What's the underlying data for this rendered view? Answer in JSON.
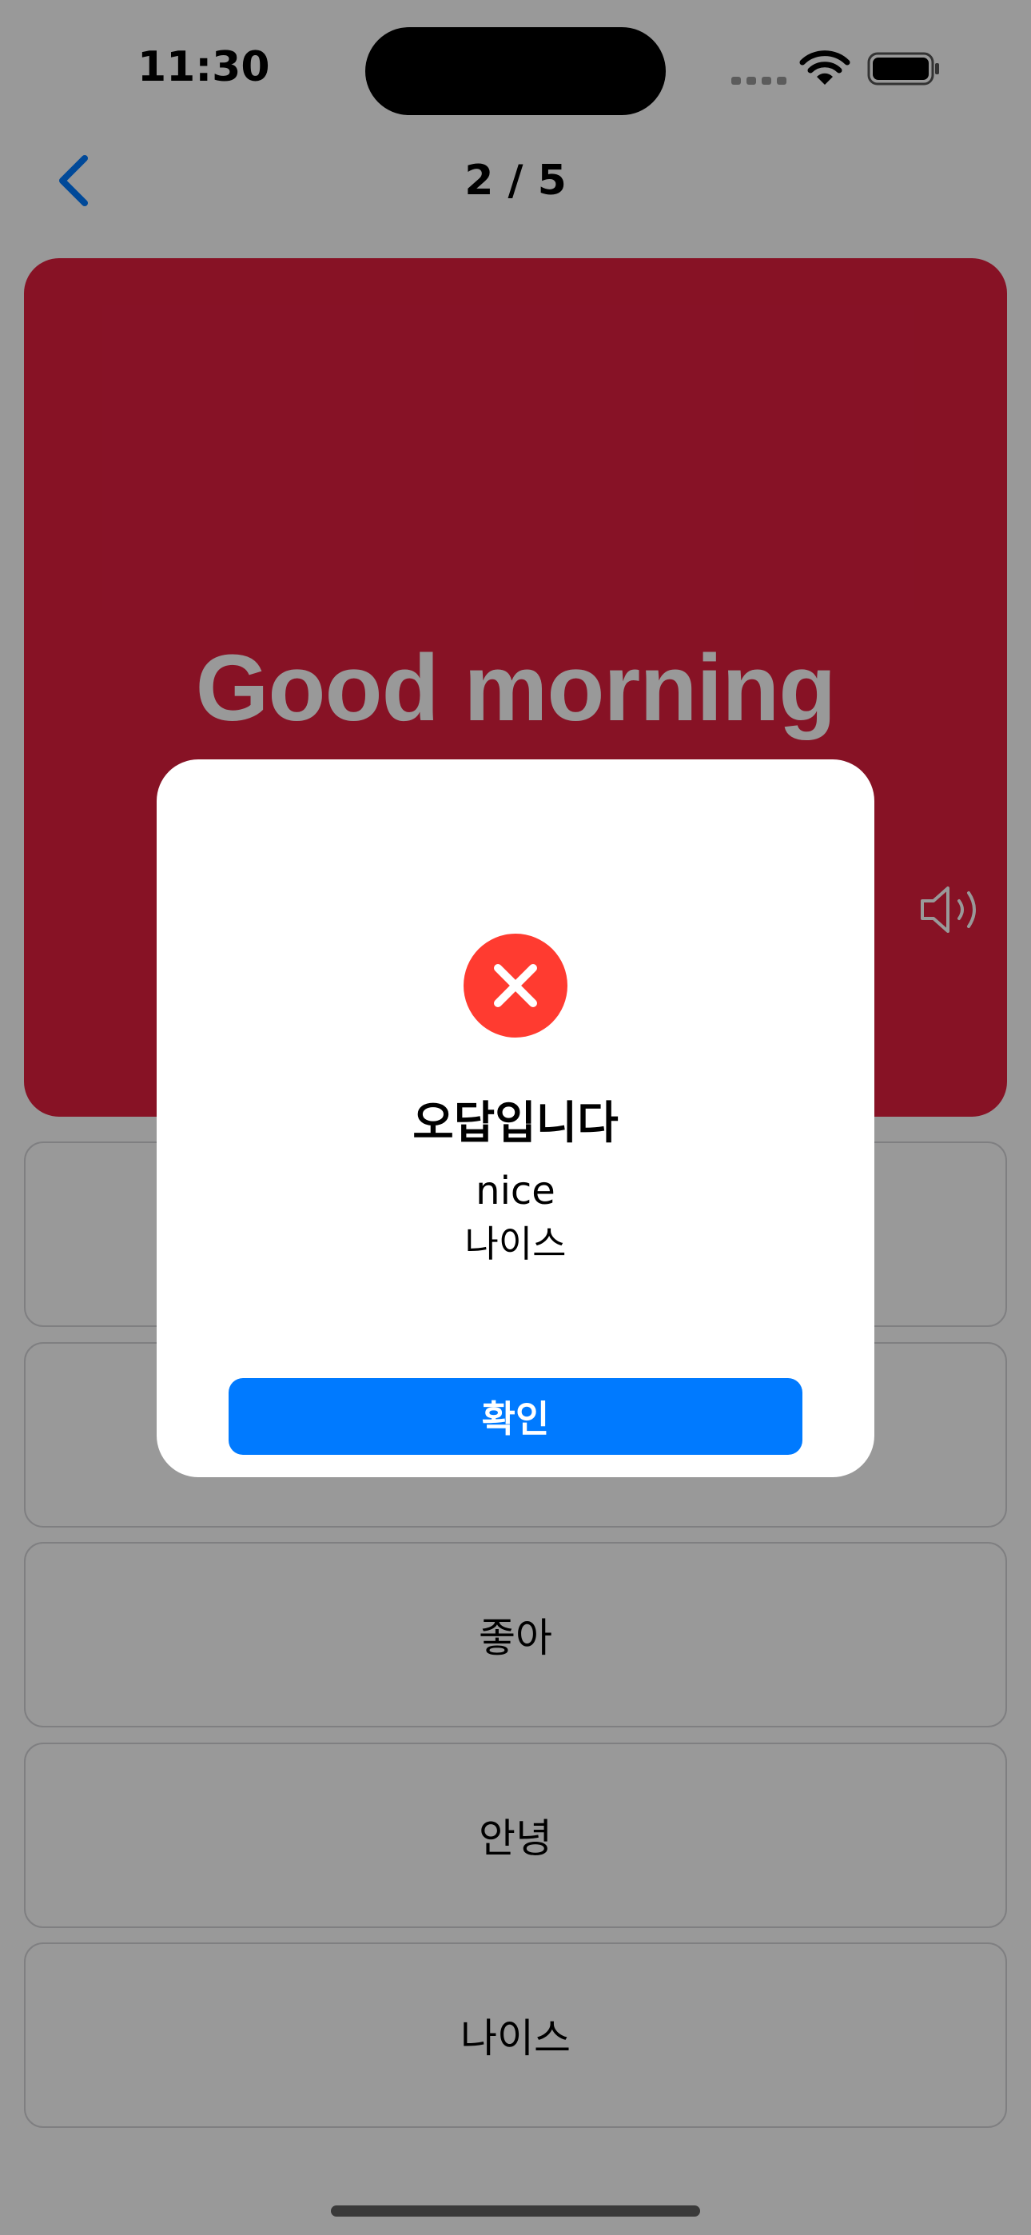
{
  "status_bar": {
    "time": "11:30"
  },
  "nav": {
    "counter": "2 / 5",
    "back_icon": "chevron-left-icon"
  },
  "card": {
    "word": "Good morning",
    "background_color": "#E11E3F",
    "speaker_icon": "speaker-icon"
  },
  "options": [
    {
      "label": ""
    },
    {
      "label": ""
    },
    {
      "label": "좋아"
    },
    {
      "label": "안녕"
    },
    {
      "label": "나이스"
    }
  ],
  "dialog": {
    "icon": "x-circle-icon",
    "icon_color": "#FF3B30",
    "title": "오답입니다",
    "answer": "nice",
    "answer_ko": "나이스",
    "confirm_label": "확인",
    "confirm_color": "#007AFF"
  }
}
